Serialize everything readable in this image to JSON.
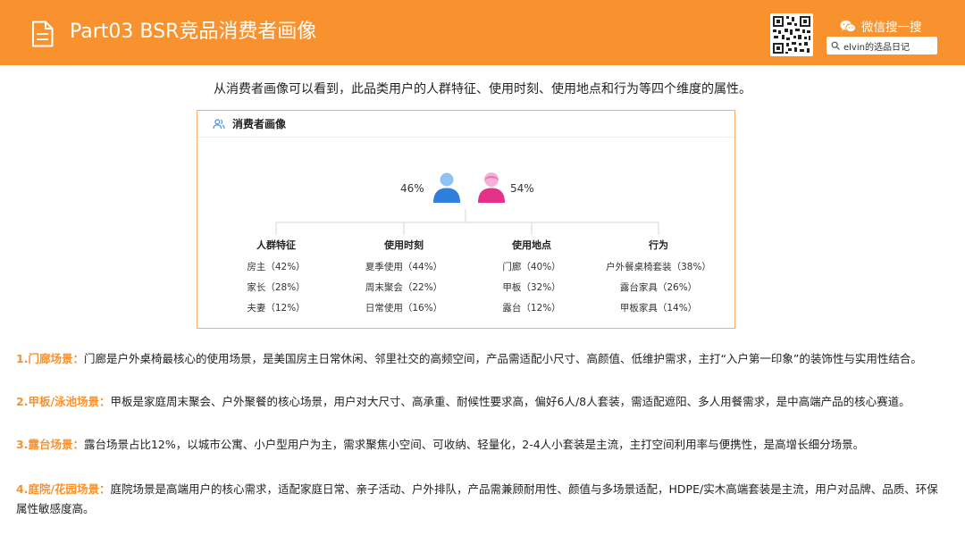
{
  "header": {
    "title": "Part03 BSR竞品消费者画像",
    "wechat_label": "微信搜一搜",
    "search_text": "elvin的选品日记",
    "bg_color": "#f7922f"
  },
  "intro": "从消费者画像可以看到，此品类用户的人群特征、使用时刻、使用地点和行为等四个维度的属性。",
  "card": {
    "title": "消费者画像",
    "male_pct": "46%",
    "female_pct": "54%",
    "male_color": "#4a90e2",
    "female_color": "#e8398e",
    "columns": [
      {
        "title": "人群特征",
        "items": [
          "房主（42%）",
          "家长（28%）",
          "夫妻（12%）"
        ]
      },
      {
        "title": "使用时刻",
        "items": [
          "夏季使用（44%）",
          "周末聚会（22%）",
          "日常使用（16%）"
        ]
      },
      {
        "title": "使用地点",
        "items": [
          "门廊（40%）",
          "甲板（32%）",
          "露台（12%）"
        ]
      },
      {
        "title": "行为",
        "items": [
          "户外餐桌椅套装（38%）",
          "露台家具（26%）",
          "甲板家具（14%）"
        ]
      }
    ]
  },
  "paragraphs": [
    {
      "label": "1.门廊场景：",
      "text": "门廊是户外桌椅最核心的使用场景，是美国房主日常休闲、邻里社交的高频空间，产品需适配小尺寸、高颜值、低维护需求，主打“入户第一印象”的装饰性与实用性结合。"
    },
    {
      "label": "2.甲板/泳池场景：",
      "text": "甲板是家庭周末聚会、户外聚餐的核心场景，用户对大尺寸、高承重、耐候性要求高，偏好6人/8人套装，需适配遮阳、多人用餐需求，是中高端产品的核心赛道。"
    },
    {
      "label": "3.露台场景：",
      "text": "露台场景占比12%，以城市公寓、小户型用户为主，需求聚焦小空间、可收纳、轻量化，2-4人小套装是主流，主打空间利用率与便携性，是高增长细分场景。"
    },
    {
      "label": "4.庭院/花园场景：",
      "text": "庭院场景是高端用户的核心需求，适配家庭日常、亲子活动、户外排队，产品需兼顾耐用性、颜值与多场景适配，HDPE/实木高端套装是主流，用户对品牌、品质、环保属性敏感度高。"
    }
  ]
}
